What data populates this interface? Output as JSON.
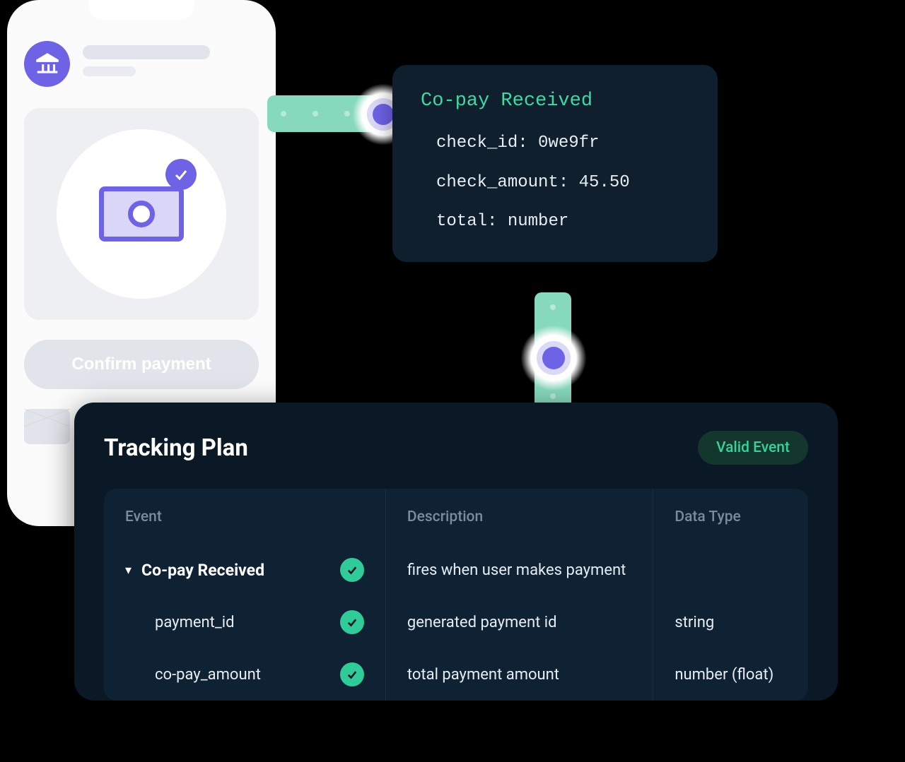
{
  "phone": {
    "confirm_label": "Confirm payment"
  },
  "event_card": {
    "title": "Co-pay Received",
    "props": [
      {
        "key": "check_id",
        "value": "0we9fr"
      },
      {
        "key": "check_amount",
        "value": "45.50"
      },
      {
        "key": "total",
        "value": "number"
      }
    ]
  },
  "tracking": {
    "title": "Tracking Plan",
    "badge": "Valid Event",
    "columns": {
      "event": "Event",
      "description": "Description",
      "data_type": "Data Type"
    },
    "event_row": {
      "name": "Co-pay Received",
      "description": "fires when user makes payment"
    },
    "properties": [
      {
        "name": "payment_id",
        "description": "generated payment id",
        "type": "string"
      },
      {
        "name": "co-pay_amount",
        "description": "total payment amount",
        "type": "number (float)"
      }
    ]
  }
}
